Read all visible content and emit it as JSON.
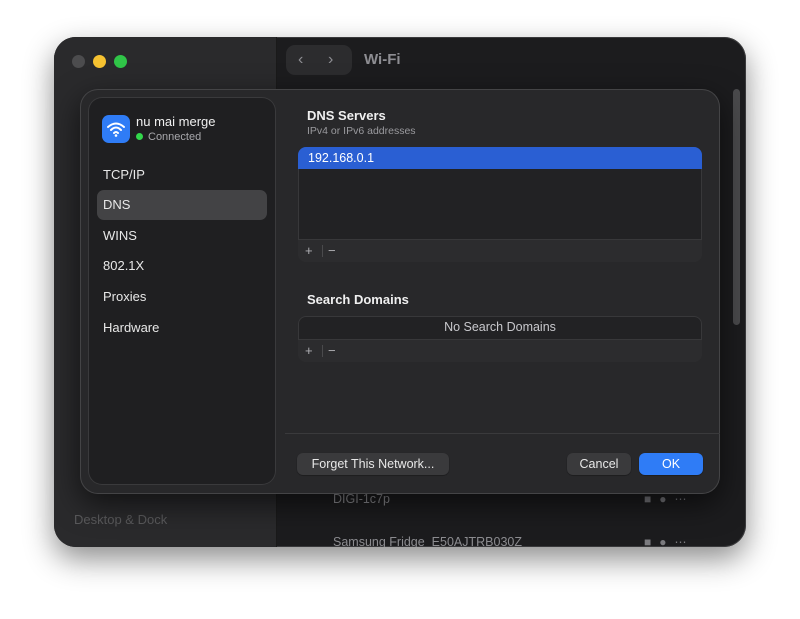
{
  "window": {
    "title": "Wi-Fi",
    "background_sidebar_item": "Desktop & Dock",
    "background_rows": [
      "DIGI-1c7p",
      "Samsung Fridge_E50AJTRB030Z"
    ]
  },
  "network": {
    "name": "nu mai merge",
    "status": "Connected",
    "icon": "wifi-icon"
  },
  "sidebar": {
    "items": [
      {
        "label": "TCP/IP",
        "selected": false
      },
      {
        "label": "DNS",
        "selected": true
      },
      {
        "label": "WINS",
        "selected": false
      },
      {
        "label": "802.1X",
        "selected": false
      },
      {
        "label": "Proxies",
        "selected": false
      },
      {
        "label": "Hardware",
        "selected": false
      }
    ]
  },
  "dns_servers": {
    "title": "DNS Servers",
    "subtitle": "IPv4 or IPv6 addresses",
    "entries": [
      "192.168.0.1"
    ],
    "add_label": "+",
    "remove_label": "−"
  },
  "search_domains": {
    "title": "Search Domains",
    "empty_text": "No Search Domains",
    "add_label": "+",
    "remove_label": "−"
  },
  "buttons": {
    "forget": "Forget This Network...",
    "cancel": "Cancel",
    "ok": "OK"
  },
  "colors": {
    "accent": "#2f7cf6",
    "selection": "#2a5fd3",
    "connected": "#32d74b"
  }
}
